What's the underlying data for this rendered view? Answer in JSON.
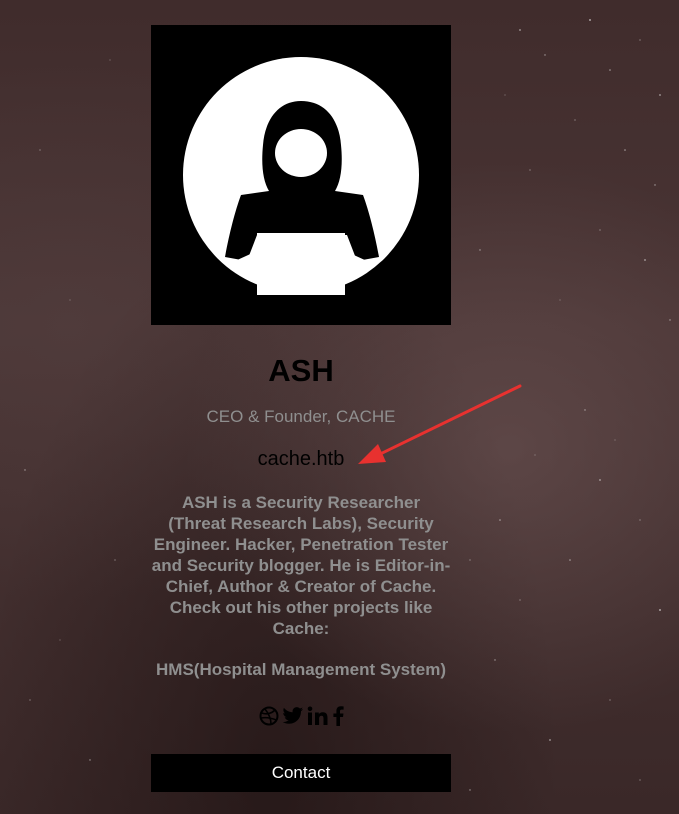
{
  "profile": {
    "name": "ASH",
    "role": "CEO & Founder, CACHE",
    "site": "cache.htb",
    "bio": "ASH is a Security Researcher (Threat Research Labs), Security Engineer. Hacker, Penetration Tester and Security blogger. He is Editor-in-Chief, Author & Creator of Cache. Check out his other projects like Cache:",
    "project": "HMS(Hospital Management System)"
  },
  "socials": [
    {
      "icon": "dribbble-icon"
    },
    {
      "icon": "twitter-icon"
    },
    {
      "icon": "linkedin-icon"
    },
    {
      "icon": "facebook-icon"
    }
  ],
  "contact": {
    "label": "Contact"
  },
  "annotation": {
    "arrow_color": "#e8312f"
  },
  "colors": {
    "background": "#3f2d2d",
    "muted_text": "#8f8f8f",
    "card_black": "#000000"
  }
}
